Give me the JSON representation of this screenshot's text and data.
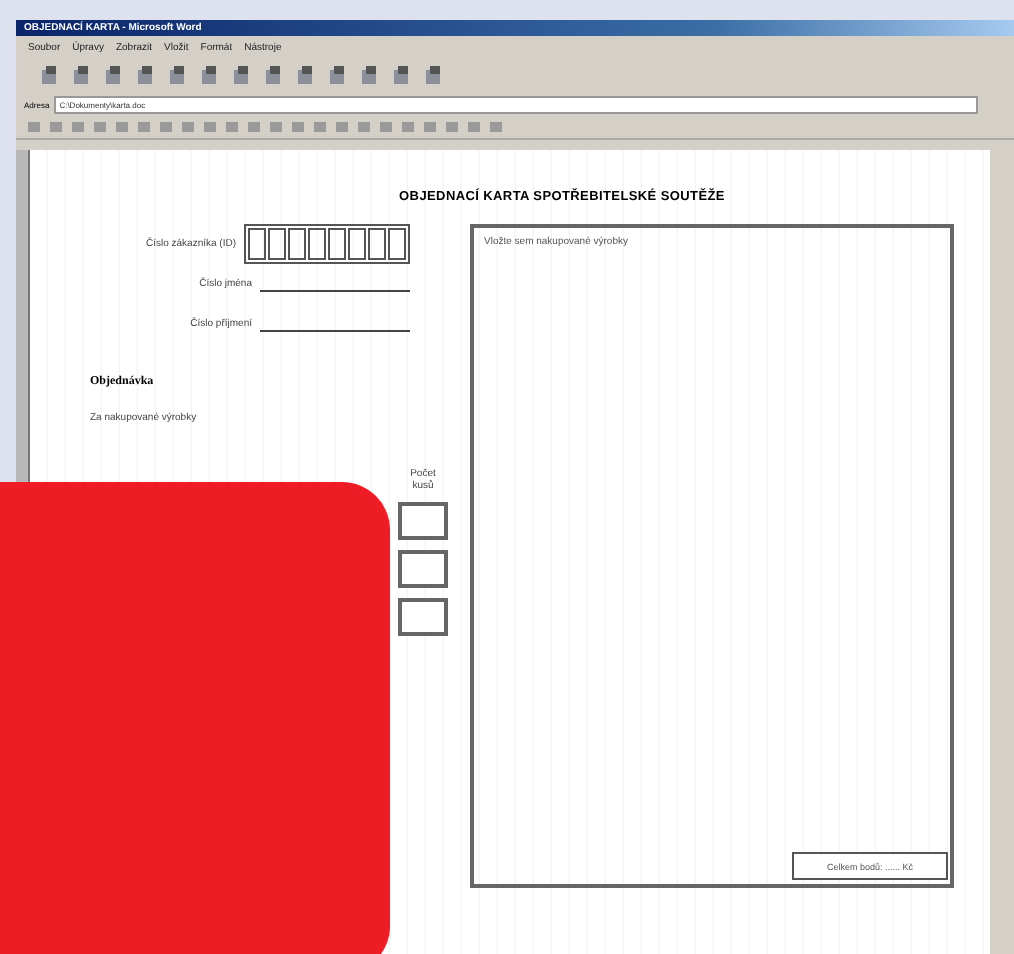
{
  "window": {
    "title": "OBJEDNACÍ KARTA - Microsoft Word"
  },
  "menu": [
    "Soubor",
    "Úpravy",
    "Zobrazit",
    "Vložit",
    "Formát",
    "Nástroje"
  ],
  "address": {
    "label": "Adresa",
    "value": "C:\\Dokumenty\\karta.doc"
  },
  "document": {
    "title": "OBJEDNACÍ KARTA SPOTŘEBITELSKÉ SOUTĚŽE",
    "fields": [
      {
        "kind": "boxes",
        "label": "Číslo zákazníka (ID)"
      },
      {
        "kind": "line",
        "label": "Číslo jména"
      },
      {
        "kind": "line",
        "label": "Číslo příjmení"
      }
    ],
    "section": "Objednávka",
    "section_text": "Za nakupované výrobky",
    "quantity_header": "Počet kusů",
    "notes_text": "Vložte sem nakupované výrobky",
    "total": "Celkem bodů: ...... Kč"
  }
}
